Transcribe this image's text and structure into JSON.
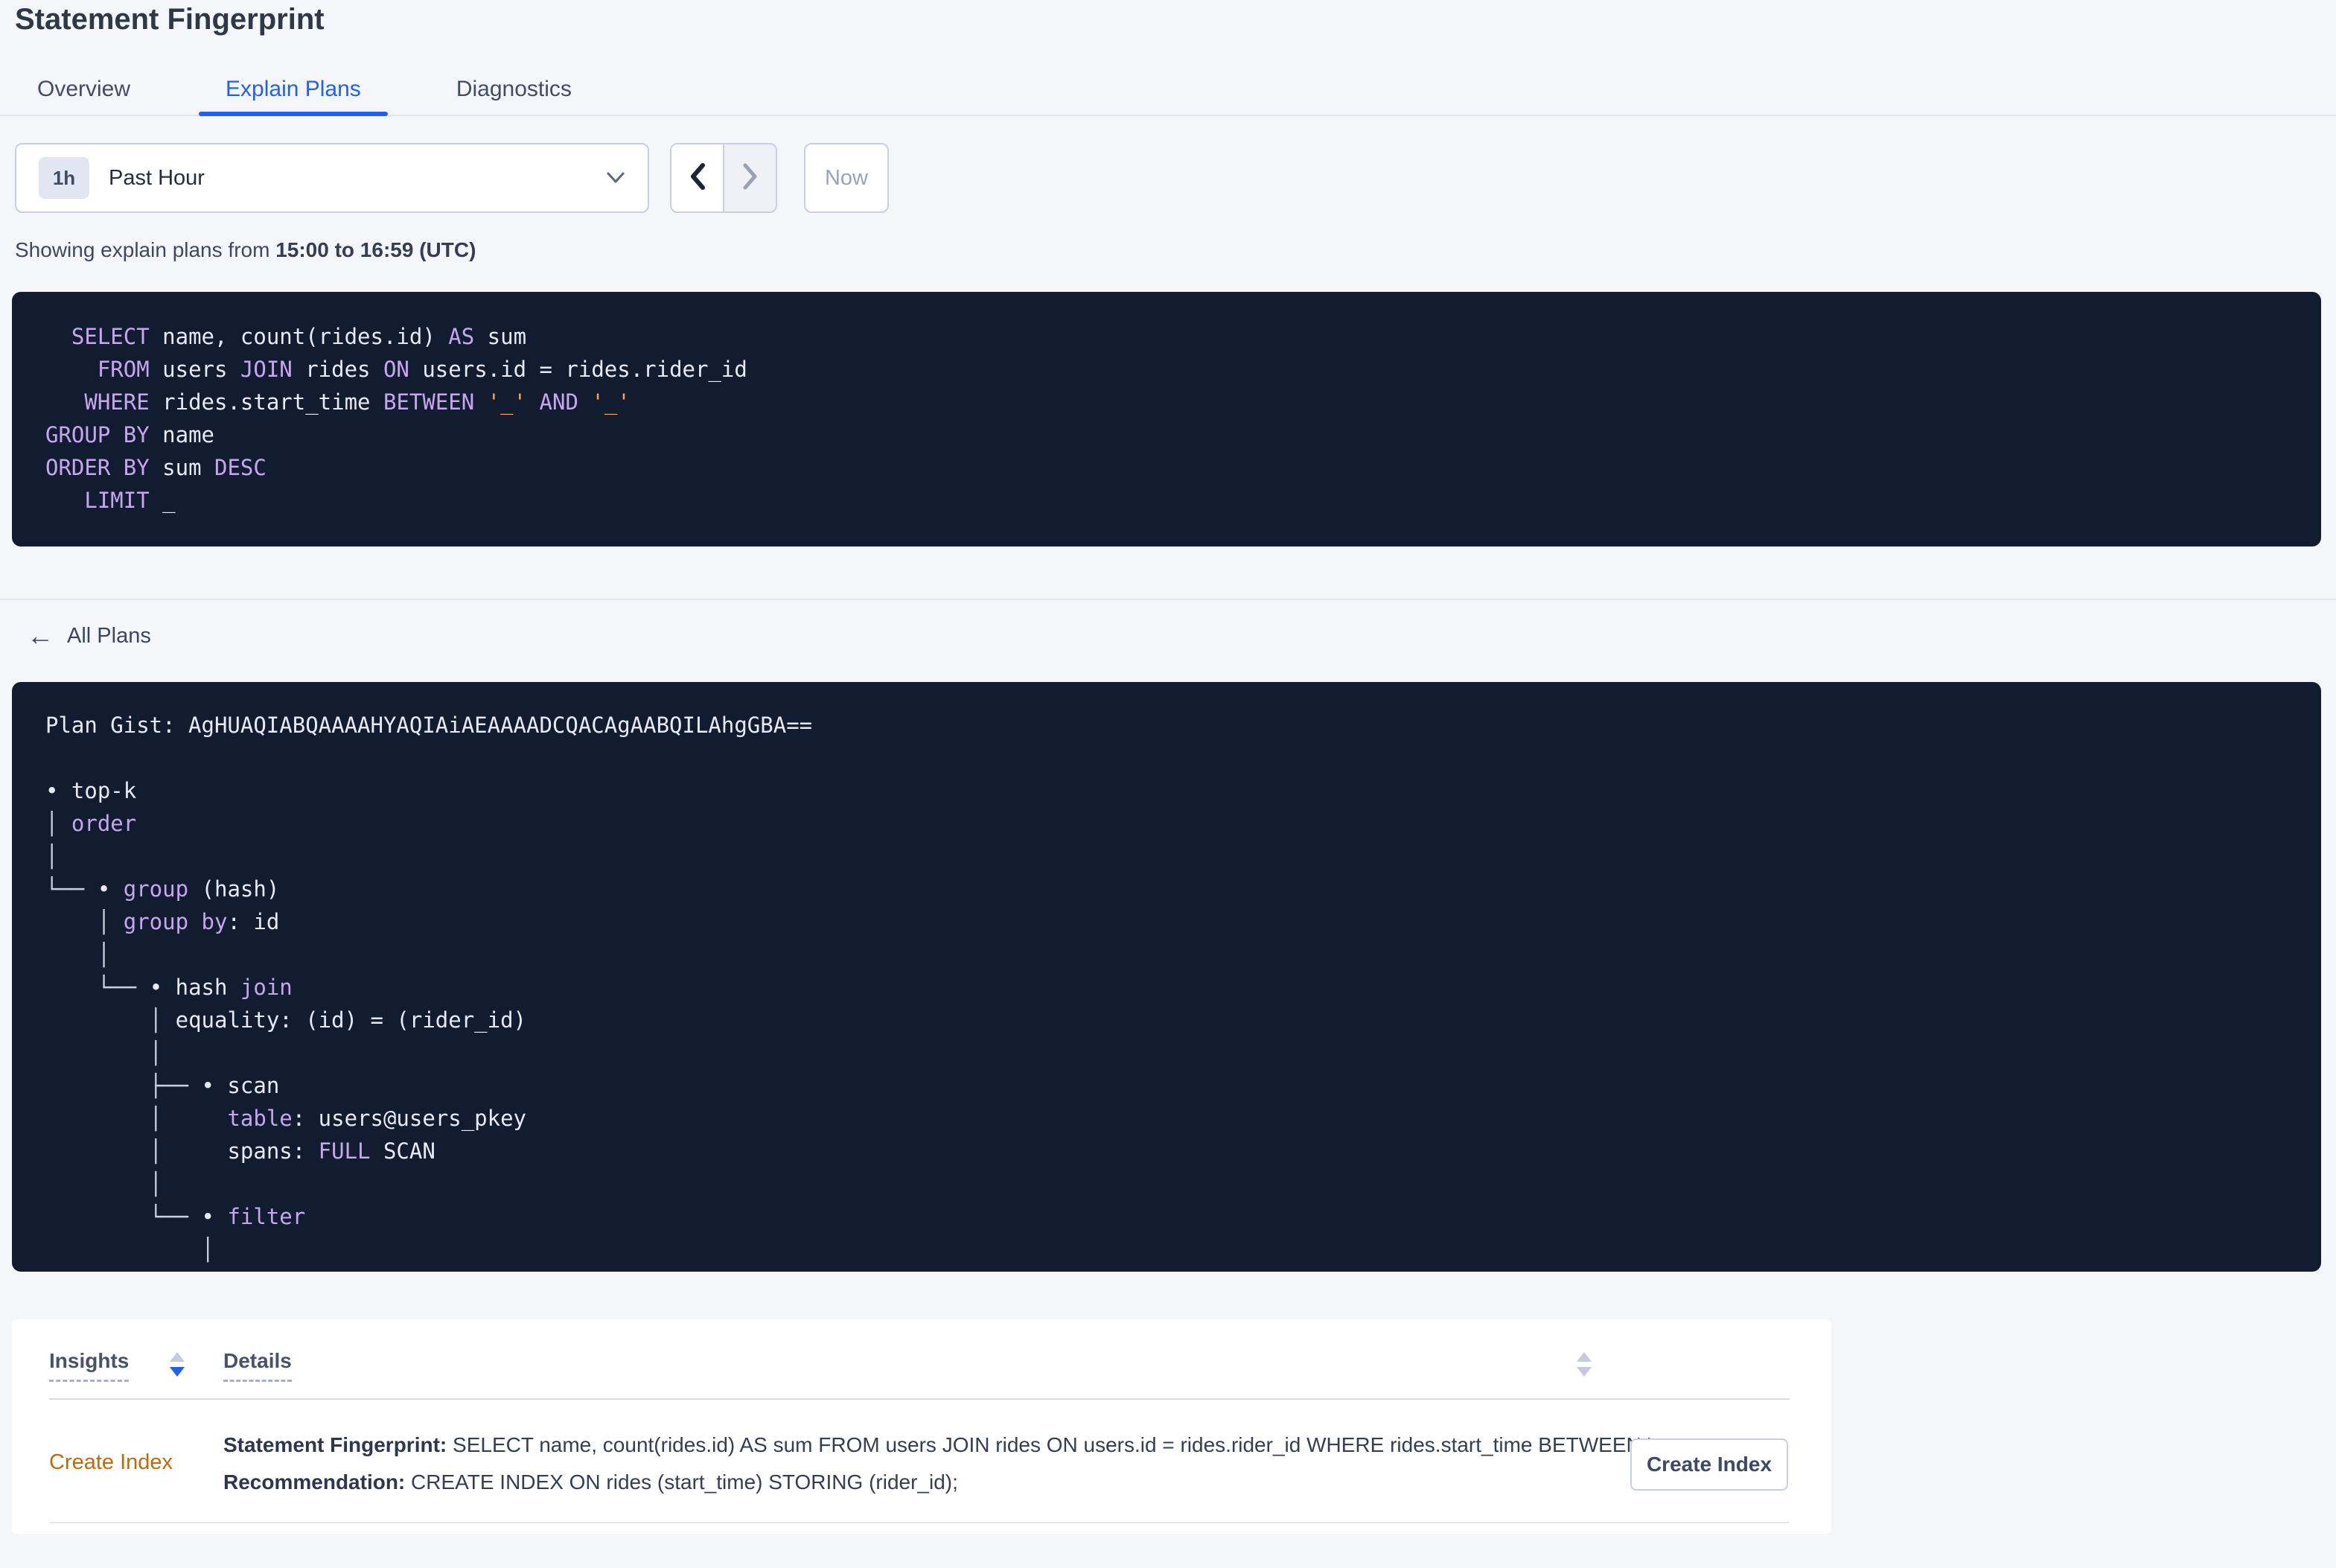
{
  "header": {
    "title": "Statement Fingerprint"
  },
  "tabs": {
    "items": [
      {
        "label": "Overview"
      },
      {
        "label": "Explain Plans"
      },
      {
        "label": "Diagnostics"
      }
    ],
    "active_index": 1
  },
  "toolbar": {
    "time_badge": "1h",
    "time_label": "Past Hour",
    "now_label": "Now"
  },
  "subtitle": {
    "prefix": "Showing explain plans from ",
    "bold_range": "15:00 to 16:59 (UTC)"
  },
  "sql_box": {
    "lines": [
      [
        {
          "t": "  "
        },
        {
          "t": "SELECT",
          "c": "kw"
        },
        {
          "t": " name, count(rides.id) "
        },
        {
          "t": "AS",
          "c": "kw"
        },
        {
          "t": " sum"
        }
      ],
      [
        {
          "t": "    "
        },
        {
          "t": "FROM",
          "c": "kw"
        },
        {
          "t": " users "
        },
        {
          "t": "JOIN",
          "c": "kw"
        },
        {
          "t": " rides "
        },
        {
          "t": "ON",
          "c": "kw"
        },
        {
          "t": " users.id = rides.rider_id"
        }
      ],
      [
        {
          "t": "   "
        },
        {
          "t": "WHERE",
          "c": "kw"
        },
        {
          "t": " rides.start_time "
        },
        {
          "t": "BETWEEN",
          "c": "kw"
        },
        {
          "t": " "
        },
        {
          "t": "'_'",
          "c": "ph"
        },
        {
          "t": " "
        },
        {
          "t": "AND",
          "c": "kw"
        },
        {
          "t": " "
        },
        {
          "t": "'_'",
          "c": "ph"
        }
      ],
      [
        {
          "t": "GROUP BY",
          "c": "kw"
        },
        {
          "t": " name"
        }
      ],
      [
        {
          "t": "ORDER BY",
          "c": "kw"
        },
        {
          "t": " sum "
        },
        {
          "t": "DESC",
          "c": "kw"
        }
      ],
      [
        {
          "t": "   "
        },
        {
          "t": "LIMIT",
          "c": "kw"
        },
        {
          "t": " _"
        }
      ]
    ]
  },
  "back_link": {
    "arrow": "←",
    "label": "All Plans"
  },
  "plan_box": {
    "lines": [
      [
        {
          "t": "Plan Gist: AgHUAQIABQAAAAHYAQIAiAEAAAADCQACAgAABQILAhgGBA==",
          "c": "nd"
        }
      ],
      [
        {
          "t": "",
          "c": "nd"
        }
      ],
      [
        {
          "t": "• top-k",
          "c": "nd"
        }
      ],
      [
        {
          "t": "│ ",
          "c": "tb"
        },
        {
          "t": "order",
          "c": "at"
        }
      ],
      [
        {
          "t": "│",
          "c": "tb"
        }
      ],
      [
        {
          "t": "└── ",
          "c": "tb"
        },
        {
          "t": "• ",
          "c": "nd"
        },
        {
          "t": "group",
          "c": "at"
        },
        {
          "t": " (hash)",
          "c": "nd"
        }
      ],
      [
        {
          "t": "    │ ",
          "c": "tb"
        },
        {
          "t": "group by",
          "c": "at"
        },
        {
          "t": ": id",
          "c": "nd"
        }
      ],
      [
        {
          "t": "    │",
          "c": "tb"
        }
      ],
      [
        {
          "t": "    └── ",
          "c": "tb"
        },
        {
          "t": "• hash ",
          "c": "nd"
        },
        {
          "t": "join",
          "c": "at"
        }
      ],
      [
        {
          "t": "        │ ",
          "c": "tb"
        },
        {
          "t": "equality: (id) = (rider_id)",
          "c": "nd"
        }
      ],
      [
        {
          "t": "        │",
          "c": "tb"
        }
      ],
      [
        {
          "t": "        ├── ",
          "c": "tb"
        },
        {
          "t": "• scan",
          "c": "nd"
        }
      ],
      [
        {
          "t": "        │     ",
          "c": "tb"
        },
        {
          "t": "table",
          "c": "at"
        },
        {
          "t": ": users@users_pkey",
          "c": "nd"
        }
      ],
      [
        {
          "t": "        │     ",
          "c": "tb"
        },
        {
          "t": "spans: ",
          "c": "nd"
        },
        {
          "t": "FULL",
          "c": "at"
        },
        {
          "t": " SCAN",
          "c": "nd"
        }
      ],
      [
        {
          "t": "        │",
          "c": "tb"
        }
      ],
      [
        {
          "t": "        └── ",
          "c": "tb"
        },
        {
          "t": "• ",
          "c": "nd"
        },
        {
          "t": "filter",
          "c": "at"
        }
      ],
      [
        {
          "t": "            │",
          "c": "tb"
        }
      ]
    ]
  },
  "insights": {
    "columns": [
      {
        "label": "Insights"
      },
      {
        "label": "Details"
      }
    ],
    "row": {
      "insight_type": "Create Index",
      "detail_line1_label": "Statement Fingerprint:",
      "detail_line1_text": " SELECT name, count(rides.id) AS sum FROM users JOIN rides ON users.id = rides.rider_id WHERE rides.start_time BETWEEN '_…",
      "detail_line2_label": "Recommendation:",
      "detail_line2_text": " CREATE INDEX ON rides (start_time) STORING (rider_id);",
      "action_label": "Create Index"
    }
  },
  "colors": {
    "accent_blue": "#2160f5",
    "code_keyword": "#c7a6ef",
    "code_text": "#e9e9f2",
    "code_placeholder": "#ffa53f",
    "insight_orange": "#c0690b",
    "dark_panel": "#121c31"
  }
}
